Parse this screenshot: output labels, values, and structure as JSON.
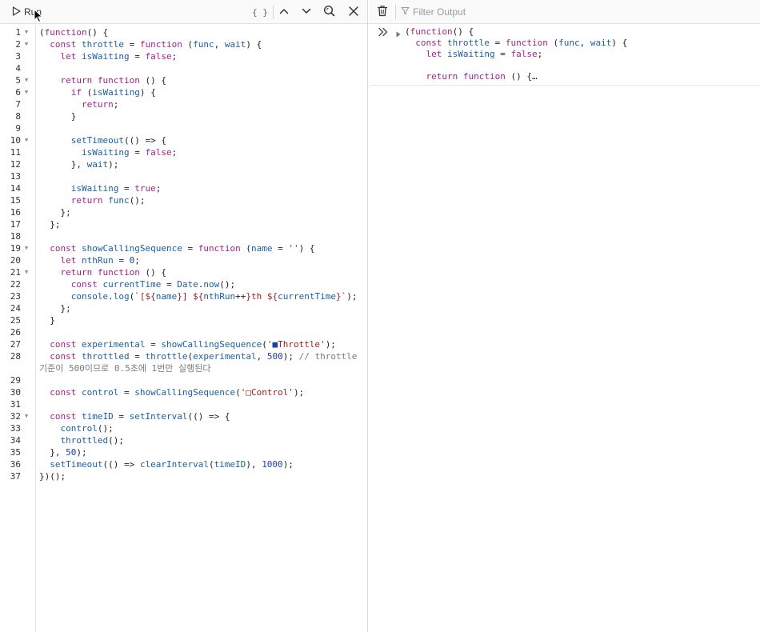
{
  "toolbar": {
    "run_label": "Run",
    "format_label": "{ }"
  },
  "output_toolbar": {
    "filter_placeholder": "Filter Output"
  },
  "code_lines": [
    {
      "n": "1",
      "fold": true,
      "html": "(<span class='kw'>function</span>() {"
    },
    {
      "n": "2",
      "fold": true,
      "html": "  <span class='kw'>const</span> <span class='nm'>throttle</span> = <span class='kw'>function</span> (<span class='nm'>func</span>, <span class='nm'>wait</span>) {"
    },
    {
      "n": "3",
      "fold": false,
      "html": "    <span class='kw'>let</span> <span class='nm'>isWaiting</span> = <span class='bool'>false</span>;"
    },
    {
      "n": "4",
      "fold": false,
      "html": ""
    },
    {
      "n": "5",
      "fold": true,
      "html": "    <span class='kw'>return</span> <span class='kw'>function</span> () {"
    },
    {
      "n": "6",
      "fold": true,
      "html": "      <span class='kw'>if</span> (<span class='nm'>isWaiting</span>) {"
    },
    {
      "n": "7",
      "fold": false,
      "html": "        <span class='kw'>return</span>;"
    },
    {
      "n": "8",
      "fold": false,
      "html": "      }"
    },
    {
      "n": "9",
      "fold": false,
      "html": ""
    },
    {
      "n": "10",
      "fold": true,
      "html": "      <span class='fn'>setTimeout</span>(() => {"
    },
    {
      "n": "11",
      "fold": false,
      "html": "        <span class='nm'>isWaiting</span> = <span class='bool'>false</span>;"
    },
    {
      "n": "12",
      "fold": false,
      "html": "      }, <span class='nm'>wait</span>);"
    },
    {
      "n": "13",
      "fold": false,
      "html": ""
    },
    {
      "n": "14",
      "fold": false,
      "html": "      <span class='nm'>isWaiting</span> = <span class='bool'>true</span>;"
    },
    {
      "n": "15",
      "fold": false,
      "html": "      <span class='kw'>return</span> <span class='fn'>func</span>();"
    },
    {
      "n": "16",
      "fold": false,
      "html": "    };"
    },
    {
      "n": "17",
      "fold": false,
      "html": "  };"
    },
    {
      "n": "18",
      "fold": false,
      "html": ""
    },
    {
      "n": "19",
      "fold": true,
      "html": "  <span class='kw'>const</span> <span class='nm'>showCallingSequence</span> = <span class='kw'>function</span> (<span class='nm'>name</span> = <span class='str'>''</span>) {"
    },
    {
      "n": "20",
      "fold": false,
      "html": "    <span class='kw'>let</span> <span class='nm'>nthRun</span> = <span class='num'>0</span>;"
    },
    {
      "n": "21",
      "fold": true,
      "html": "    <span class='kw'>return</span> <span class='kw'>function</span> () {"
    },
    {
      "n": "22",
      "fold": false,
      "html": "      <span class='kw'>const</span> <span class='nm'>currentTime</span> = <span class='fn'>Date</span>.<span class='fn'>now</span>();"
    },
    {
      "n": "23",
      "fold": false,
      "html": "      <span class='fn'>console</span>.<span class='fn'>log</span>(<span class='str'>`[${</span><span class='nm'>name</span><span class='str'>}] ${</span><span class='nm'>nthRun</span>++<span class='str'>}th ${</span><span class='nm'>currentTime</span><span class='str'>}`</span>);"
    },
    {
      "n": "24",
      "fold": false,
      "html": "    };"
    },
    {
      "n": "25",
      "fold": false,
      "html": "  }"
    },
    {
      "n": "26",
      "fold": false,
      "html": ""
    },
    {
      "n": "27",
      "fold": false,
      "html": "  <span class='kw'>const</span> <span class='nm'>experimental</span> = <span class='fn'>showCallingSequence</span>(<span class='str'>'<span class=\"num\">■</span>Throttle'</span>);"
    },
    {
      "n": "28",
      "fold": false,
      "wrap": true,
      "html": "  <span class='kw'>const</span> <span class='nm'>throttled</span> = <span class='fn'>throttle</span>(<span class='nm'>experimental</span>, <span class='num'>500</span>); <span class='cm'>// throttle 기준이 500이므로 0.5초에 1번만 실행된다</span>"
    },
    {
      "n": "29",
      "fold": false,
      "html": ""
    },
    {
      "n": "30",
      "fold": false,
      "html": "  <span class='kw'>const</span> <span class='nm'>control</span> = <span class='fn'>showCallingSequence</span>(<span class='str'>'□Control'</span>);"
    },
    {
      "n": "31",
      "fold": false,
      "html": ""
    },
    {
      "n": "32",
      "fold": true,
      "html": "  <span class='kw'>const</span> <span class='nm'>timeID</span> = <span class='fn'>setInterval</span>(() => {"
    },
    {
      "n": "33",
      "fold": false,
      "html": "    <span class='fn'>control</span>();"
    },
    {
      "n": "34",
      "fold": false,
      "html": "    <span class='fn'>throttled</span>();"
    },
    {
      "n": "35",
      "fold": false,
      "html": "  }, <span class='num'>50</span>);"
    },
    {
      "n": "36",
      "fold": false,
      "html": "  <span class='fn'>setTimeout</span>(() => <span class='fn'>clearInterval</span>(<span class='nm'>timeID</span>), <span class='num'>1000</span>);"
    },
    {
      "n": "37",
      "fold": false,
      "html": "})();"
    }
  ],
  "console_output": [
    "(<span class='kw'>function</span>() {",
    "  <span class='kw'>const</span> <span class='nm'>throttle</span> = <span class='kw'>function</span> (<span class='nm'>func</span>, <span class='nm'>wait</span>) {",
    "    <span class='kw'>let</span> <span class='nm'>isWaiting</span> = <span class='bool'>false</span>;",
    "",
    "    <span class='kw'>return</span> <span class='kw'>function</span> () {…"
  ],
  "icons": {
    "run": "play-icon",
    "up": "chevron-up-icon",
    "down": "chevron-down-icon",
    "search": "magnifier-icon",
    "close": "close-icon",
    "trash": "trash-icon",
    "filter": "filter-icon",
    "prompt": "double-chevron-icon",
    "disclosure": "disclosure-triangle-icon"
  }
}
